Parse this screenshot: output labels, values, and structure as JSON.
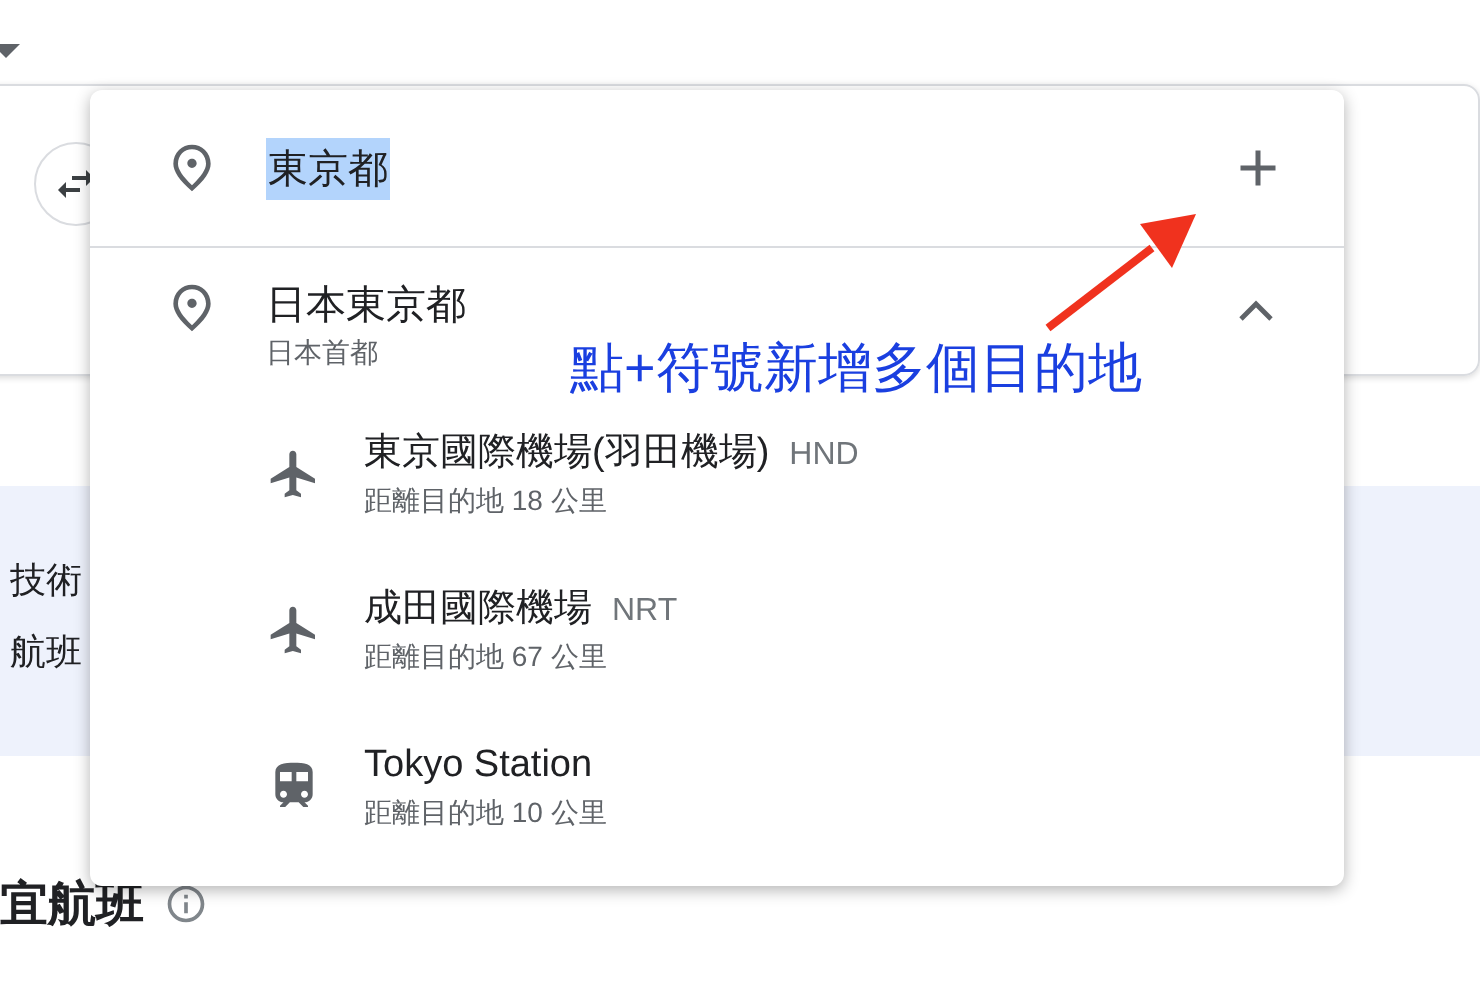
{
  "search": {
    "value": "東京都",
    "text_selected": true
  },
  "suggestions": [
    {
      "kind": "city",
      "title": "日本東京都",
      "subtitle": "日本首都",
      "expanded": true,
      "children": [
        {
          "kind": "airport",
          "name": "東京國際機場(羽田機場)",
          "code": "HND",
          "distance": "距離目的地 18 公里"
        },
        {
          "kind": "airport",
          "name": "成田國際機場",
          "code": "NRT",
          "distance": "距離目的地 67 公里"
        },
        {
          "kind": "station",
          "name": "Tokyo Station",
          "distance": "距離目的地 10 公里"
        }
      ]
    }
  ],
  "annotation": {
    "text": "點+符號新增多個目的地"
  },
  "background": {
    "band_lines": [
      "技術",
      "航班"
    ],
    "heading": "宜航班"
  }
}
